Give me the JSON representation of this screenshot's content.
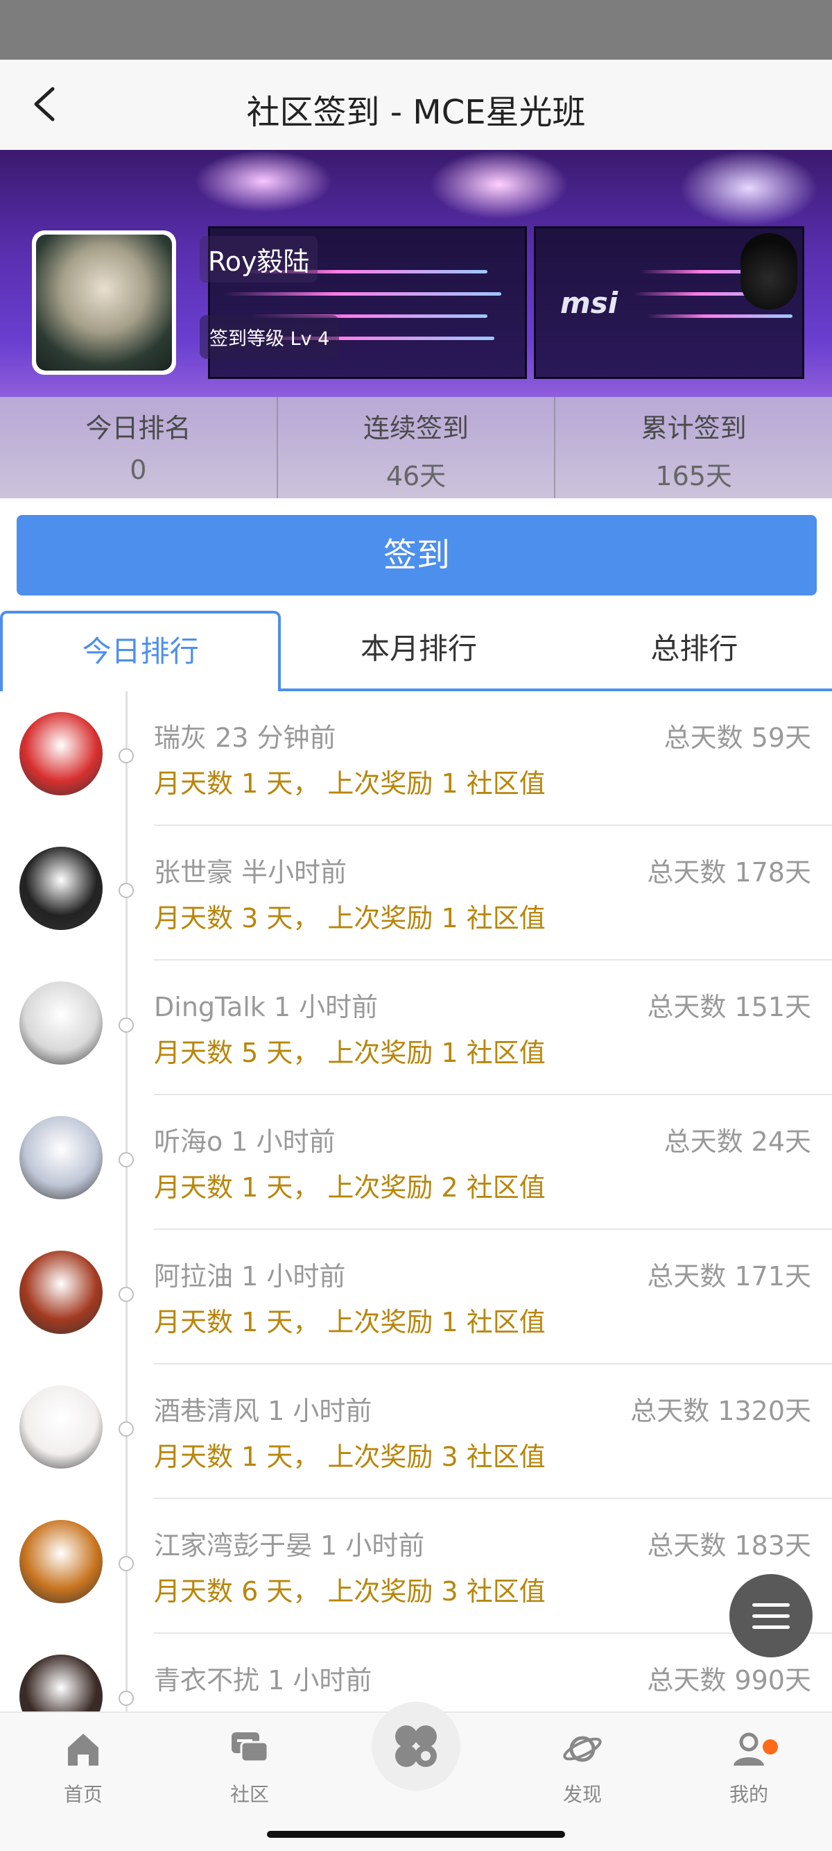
{
  "header": {
    "title": "社区签到 - MCE星光班"
  },
  "banner": {
    "brand": "msi"
  },
  "profile": {
    "username": "Roy毅陆",
    "level_label": "签到等级 Lv 4"
  },
  "stats": [
    {
      "label": "今日排名",
      "value": "0"
    },
    {
      "label": "连续签到",
      "value": "46天"
    },
    {
      "label": "累计签到",
      "value": "165天"
    }
  ],
  "checkin_button": "签到",
  "tabs": [
    {
      "label": "今日排行",
      "active": true
    },
    {
      "label": "本月排行",
      "active": false
    },
    {
      "label": "总排行",
      "active": false
    }
  ],
  "rank_list": [
    {
      "name_time": "瑞灰 23 分钟前",
      "total": "总天数 59天",
      "sub": "月天数 1 天， 上次奖励 1 社区值",
      "avatar_color": "#d82f2f"
    },
    {
      "name_time": "张世豪 半小时前",
      "total": "总天数 178天",
      "sub": "月天数 3 天， 上次奖励 1 社区值",
      "avatar_color": "#222222"
    },
    {
      "name_time": "DingTalk 1 小时前",
      "total": "总天数 151天",
      "sub": "月天数 5 天， 上次奖励 1 社区值",
      "avatar_color": "#d9d9d9"
    },
    {
      "name_time": "听海o 1 小时前",
      "total": "总天数 24天",
      "sub": "月天数 1 天， 上次奖励 2 社区值",
      "avatar_color": "#bfc6d6"
    },
    {
      "name_time": "阿拉油 1 小时前",
      "total": "总天数 171天",
      "sub": "月天数 1 天， 上次奖励 1 社区值",
      "avatar_color": "#a33a20"
    },
    {
      "name_time": "酒巷清风 1 小时前",
      "total": "总天数 1320天",
      "sub": "月天数 1 天， 上次奖励 3 社区值",
      "avatar_color": "#f2eeee"
    },
    {
      "name_time": "江家湾彭于晏 1 小时前",
      "total": "总天数 183天",
      "sub": "月天数 6 天， 上次奖励 3 社区值",
      "avatar_color": "#c8741f"
    },
    {
      "name_time": "青衣不扰 1 小时前",
      "total": "总天数 990天",
      "sub": "",
      "avatar_color": "#3a2a26"
    }
  ],
  "tabbar": [
    {
      "label": "首页",
      "icon": "home-icon"
    },
    {
      "label": "社区",
      "icon": "chat-icon"
    },
    {
      "label": "",
      "icon": "apps-icon"
    },
    {
      "label": "发现",
      "icon": "planet-icon"
    },
    {
      "label": "我的",
      "icon": "user-icon"
    }
  ],
  "colors": {
    "accent": "#4d8fec",
    "gold_text": "#b8860b",
    "badge": "#ff6a1a"
  }
}
